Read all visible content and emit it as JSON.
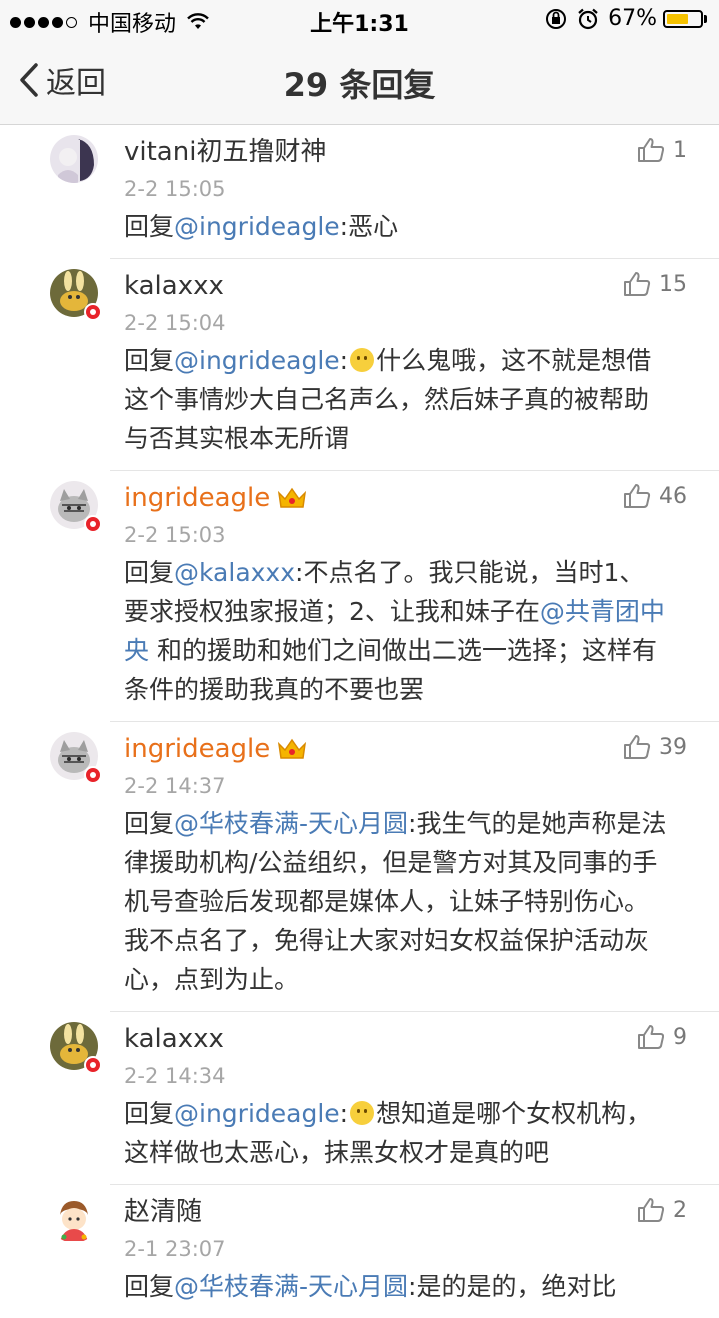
{
  "status_bar": {
    "carrier": "中国移动",
    "time": "上午1:31",
    "battery": "67%",
    "battery_level": 0.67
  },
  "nav": {
    "back_label": "返回",
    "title": "29 条回复"
  },
  "comments": [
    {
      "username": "vitani初五撸财神",
      "timestamp": "2-2 15:05",
      "likes": "1",
      "reply_prefix": "回复",
      "mention": "@ingrideagle",
      "body": ":恶心",
      "avatar": "vitani-avatar"
    },
    {
      "username": "kalaxxx",
      "timestamp": "2-2 15:04",
      "likes": "15",
      "reply_prefix": "回复",
      "mention": "@ingrideagle",
      "body_before_emoji": ":",
      "body": "什么鬼哦，这不就是想借这个事情炒大自己名声么，然后妹子真的被帮助与否其实根本无所谓",
      "avatar": "kalaxxx-avatar"
    },
    {
      "username": "ingrideagle",
      "timestamp": "2-2 15:03",
      "likes": "46",
      "reply_prefix": "回复",
      "mention": "@kalaxxx",
      "body": ":不点名了。我只能说，当时1、要求授权独家报道；2、让我和妹子在",
      "mention2": "@共青团中央",
      "body2": " 和的援助和她们之间做出二选一选择；这样有条件的援助我真的不要也罢",
      "avatar": "ingrideagle-avatar"
    },
    {
      "username": "ingrideagle",
      "timestamp": "2-2 14:37",
      "likes": "39",
      "reply_prefix": "回复",
      "mention": "@华枝春满-天心月圆",
      "body": ":我生气的是她声称是法律援助机构/公益组织，但是警方对其及同事的手机号查验后发现都是媒体人，让妹子特别伤心。我不点名了，免得让大家对妇女权益保护活动灰心，点到为止。",
      "avatar": "ingrideagle-avatar"
    },
    {
      "username": "kalaxxx",
      "timestamp": "2-2 14:34",
      "likes": "9",
      "reply_prefix": "回复",
      "mention": "@ingrideagle",
      "body_before_emoji": ":",
      "body": "想知道是哪个女权机构，这样做也太恶心，抹黑女权才是真的吧",
      "avatar": "kalaxxx-avatar"
    },
    {
      "username": "赵清随",
      "timestamp": "2-1 23:07",
      "likes": "2",
      "reply_prefix": "回复",
      "mention": "@华枝春满-天心月圆",
      "body": ":是的是的，绝对比",
      "avatar": "zhaoqingsui-avatar"
    }
  ],
  "colors": {
    "mention": "#4a7bb5",
    "vip_name": "#e8701a",
    "timestamp": "#a6a6a6",
    "badge": "#e8232a"
  }
}
